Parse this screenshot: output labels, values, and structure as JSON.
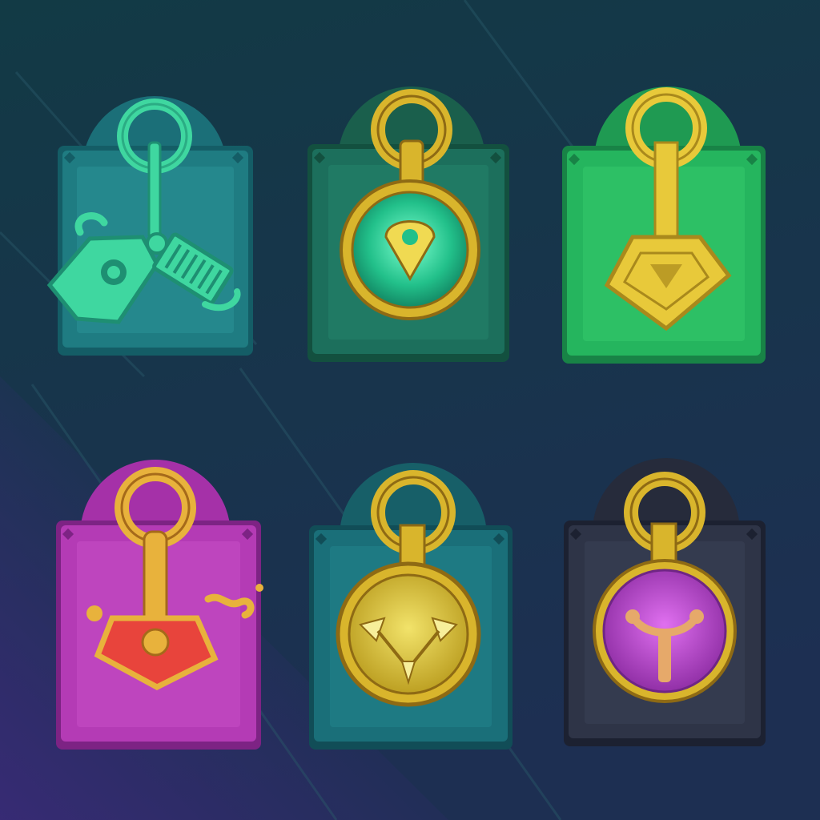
{
  "background": {
    "top_color": "#123a45",
    "bottom_color": "#1d2f52",
    "accent_color": "#3a2a78"
  },
  "gold": {
    "light": "#f0da52",
    "mid": "#d9b52c",
    "dark": "#8e6a14"
  },
  "badges": [
    {
      "id": "badge-1",
      "name": "teal-key-lock-badge",
      "plate": "#1f7c82",
      "plate_light": "#2a9298",
      "plate_dark": "#145d66",
      "arch": "#1b6f78",
      "icon": "key-and-tag-icon",
      "emblem": "#3fd7a0",
      "emblem_dark": "#1e8f72"
    },
    {
      "id": "badge-2",
      "name": "forest-ring-lock-badge",
      "plate": "#1c6f5c",
      "plate_light": "#24836b",
      "plate_dark": "#13503f",
      "arch": "#1a5f4c",
      "icon": "green-orb-medallion-icon",
      "emblem": "#2fcc82",
      "emblem_dark": "#188a5a"
    },
    {
      "id": "badge-3",
      "name": "emerald-hammer-lock-badge",
      "plate": "#25b55e",
      "plate_light": "#34c96c",
      "plate_dark": "#188346",
      "arch": "#1f9a52",
      "icon": "gold-shield-pin-icon",
      "emblem": "#e8c93a",
      "emblem_dark": "#a9891c"
    },
    {
      "id": "badge-4",
      "name": "magenta-shield-lock-badge",
      "plate": "#b43bb5",
      "plate_light": "#c84fc8",
      "plate_dark": "#7d2384",
      "arch": "#a531a8",
      "icon": "red-shield-pin-icon",
      "emblem": "#e8443c",
      "emblem_dark": "#b52a2a"
    },
    {
      "id": "badge-5",
      "name": "sea-gold-coin-lock-badge",
      "plate": "#1a6f79",
      "plate_light": "#22838c",
      "plate_dark": "#114d57",
      "arch": "#175f68",
      "icon": "gold-arrows-medallion-icon",
      "emblem": "#d9c22f",
      "emblem_dark": "#8b7a14"
    },
    {
      "id": "badge-6",
      "name": "slate-purple-lock-badge",
      "plate": "#2e3447",
      "plate_light": "#3a4156",
      "plate_dark": "#1c2131",
      "arch": "#262b3b",
      "icon": "purple-fork-medallion-icon",
      "emblem": "#b23fc6",
      "emblem_dark": "#6f2585"
    }
  ]
}
